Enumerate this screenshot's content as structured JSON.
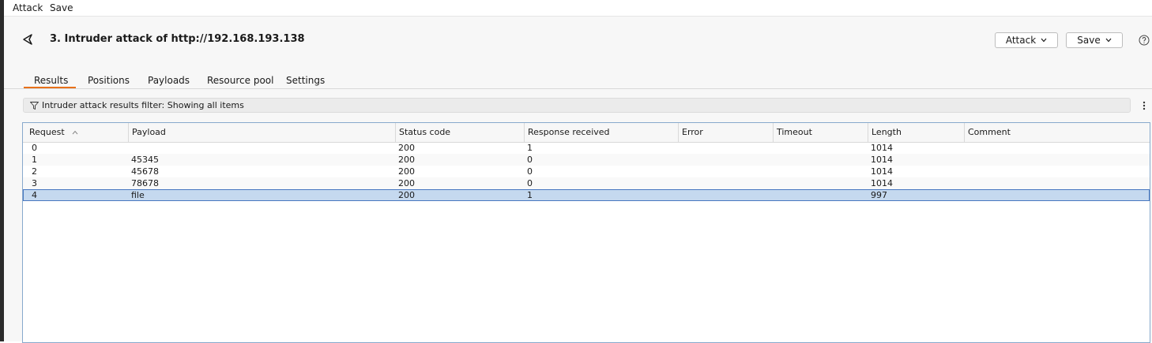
{
  "menubar": {
    "items": [
      "Attack",
      "Save"
    ]
  },
  "header": {
    "title": "3. Intruder attack of http://192.168.193.138",
    "attack_button": "Attack",
    "save_button": "Save"
  },
  "tabs": [
    {
      "label": "Results",
      "active": true
    },
    {
      "label": "Positions"
    },
    {
      "label": "Payloads"
    },
    {
      "label": "Resource pool"
    },
    {
      "label": "Settings"
    }
  ],
  "filter": {
    "text": "Intruder attack results filter: Showing all items"
  },
  "table": {
    "sort_column": "Request",
    "sort_direction": "ascending",
    "columns": [
      "Request",
      "Payload",
      "Status code",
      "Response received",
      "Error",
      "Timeout",
      "Length",
      "Comment"
    ],
    "rows": [
      [
        "0",
        "",
        "200",
        "1",
        "",
        "",
        "1014",
        ""
      ],
      [
        "1",
        "45345",
        "200",
        "0",
        "",
        "",
        "1014",
        ""
      ],
      [
        "2",
        "45678",
        "200",
        "0",
        "",
        "",
        "1014",
        ""
      ],
      [
        "3",
        "78678",
        "200",
        "0",
        "",
        "",
        "1014",
        ""
      ],
      [
        "4",
        "file",
        "200",
        "1",
        "",
        "",
        "997",
        ""
      ]
    ],
    "selected_row": 4
  },
  "colors": {
    "accent": "#e8701a",
    "selection": "#c5d9ef",
    "selection_border": "#4978c0"
  }
}
